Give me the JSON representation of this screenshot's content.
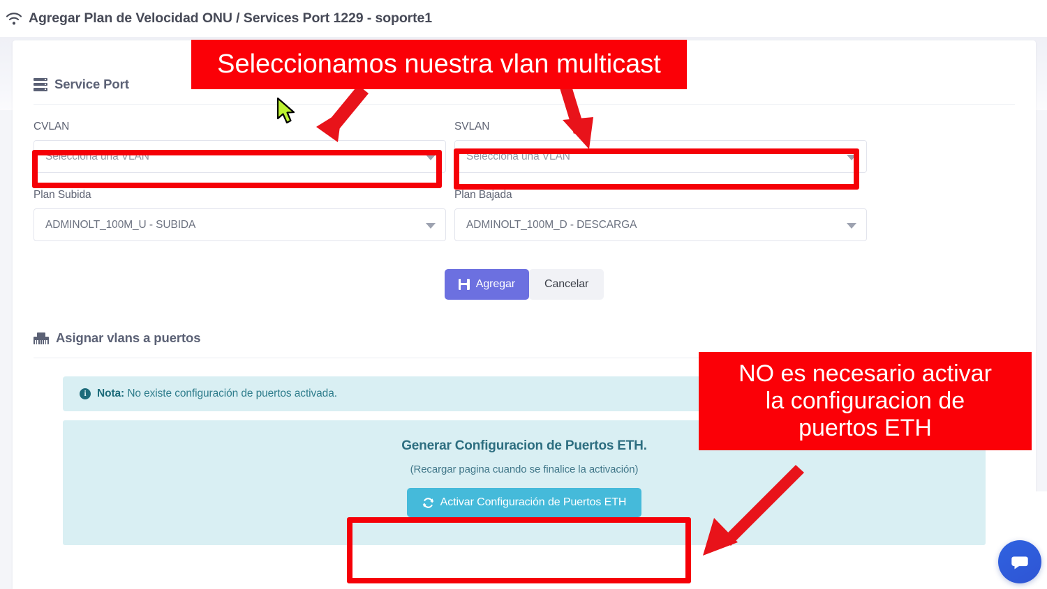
{
  "header": {
    "icon": "wifi-icon",
    "title": "Agregar Plan de Velocidad ONU / Services Port 1229 - soporte1"
  },
  "service_port_section": {
    "icon": "server-stack-icon",
    "title": "Service Port",
    "fields": [
      {
        "label": "CVLAN",
        "value": "Selecciona una VLAN",
        "is_placeholder": true
      },
      {
        "label": "SVLAN",
        "value": "Selecciona una VLAN",
        "is_placeholder": true
      },
      {
        "label": "Plan Subida",
        "value": "ADMINOLT_100M_U - SUBIDA",
        "is_placeholder": false
      },
      {
        "label": "Plan Bajada",
        "value": "ADMINOLT_100M_D - DESCARGA",
        "is_placeholder": false
      }
    ],
    "buttons": {
      "submit": "Agregar",
      "submit_icon": "save-icon",
      "cancel": "Cancelar"
    }
  },
  "ports_section": {
    "icon": "ethernet-port-icon",
    "title": "Asignar vlans a puertos",
    "alert": {
      "icon": "info-circle-icon",
      "label": "Nota:",
      "text": " No existe configuración de puertos activada."
    },
    "generate_panel": {
      "title": "Generar Configuracion de Puertos ETH.",
      "subtitle": "(Recargar pagina cuando se finalice la activación)",
      "button": "Activar Configuración de Puertos ETH",
      "button_icon": "refresh-icon"
    }
  },
  "annotations": {
    "vlan_note": "Seleccionamos nuestra vlan multicast",
    "eth_note_lines": [
      "NO es necesario activar",
      "la configuracion de",
      "puertos ETH"
    ]
  },
  "chat_widget": {
    "icon": "chat-bubble-icon"
  },
  "colors": {
    "annotation_red": "#fb0007",
    "highlight_border": "#f50007",
    "primary_button": "#6c70e0",
    "cyan_button": "#45bada",
    "alert_bg": "#d9eff3",
    "chat_blue": "#2f55d4",
    "cursor_green": "#bdf232"
  }
}
